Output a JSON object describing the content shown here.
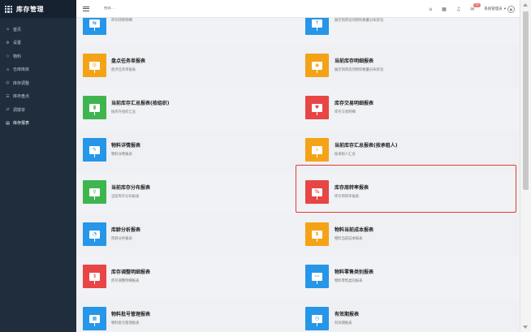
{
  "app": {
    "title": "库存管理"
  },
  "sidebar": {
    "items": [
      {
        "label": "首页",
        "icon": "home-icon",
        "glyph": "⌂",
        "active": false
      },
      {
        "label": "设置",
        "icon": "gear-icon",
        "glyph": "⚙",
        "active": false
      },
      {
        "label": "物料",
        "icon": "cube-icon",
        "glyph": "◇",
        "active": false
      },
      {
        "label": "仓库库房",
        "icon": "warehouse-icon",
        "glyph": "⌂",
        "active": false
      },
      {
        "label": "库存调整",
        "icon": "adjust-icon",
        "glyph": "◎",
        "active": false
      },
      {
        "label": "库存盘点",
        "icon": "check-icon",
        "glyph": "☰",
        "active": false
      },
      {
        "label": "调拨单",
        "icon": "transfer-icon",
        "glyph": "⇄",
        "active": false
      },
      {
        "label": "库存报表",
        "icon": "chart-icon",
        "glyph": "▤",
        "active": true
      }
    ]
  },
  "header": {
    "search_placeholder": "搜索...",
    "notification_count": "10",
    "user_name": "系统管理员"
  },
  "reports": [
    {
      "title": "",
      "desc": "库存转移明细",
      "color": "blue",
      "glyph": "⇆"
    },
    {
      "title": "",
      "desc": "展示到库房的物料数量分布状况",
      "color": "blue",
      "glyph": "⇡"
    },
    {
      "title": "盘点任务单报表",
      "desc": "盘点任务单报表",
      "color": "orange",
      "glyph": "☰"
    },
    {
      "title": "当前库存明细报表",
      "desc": "展示到库房的物料数量分布状况",
      "color": "orange",
      "glyph": "◉"
    },
    {
      "title": "当前库存汇总报表(按组织)",
      "desc": "按库存组织汇总",
      "color": "green",
      "glyph": "▮"
    },
    {
      "title": "库存交易明细报表",
      "desc": "库存交易明细",
      "color": "red",
      "glyph": "♥"
    },
    {
      "title": "物料详情报表",
      "desc": "物料详情报表",
      "color": "blue",
      "glyph": "✎"
    },
    {
      "title": "当前库存汇总报表(按承租人)",
      "desc": "按承租人汇总",
      "color": "orange",
      "glyph": "⇣"
    },
    {
      "title": "当前库存分布报表",
      "desc": "当前库存分布报表",
      "color": "green",
      "glyph": "⚲"
    },
    {
      "title": "库存周转率报表",
      "desc": "库存周转率报表",
      "color": "red",
      "glyph": "%"
    },
    {
      "title": "库龄分析报表",
      "desc": "库龄分析报表",
      "color": "blue",
      "glyph": "◔"
    },
    {
      "title": "物料当前成本报表",
      "desc": "物料当前成本报表",
      "color": "orange",
      "glyph": "$"
    },
    {
      "title": "库存调整明细报表",
      "desc": "库存调整明细报表",
      "color": "red",
      "glyph": "⇕"
    },
    {
      "title": "物料零售类别报表",
      "desc": "物料零售类别报表",
      "color": "blue",
      "glyph": "⋯"
    },
    {
      "title": "物料批号管理报表",
      "desc": "物料批号管理报表",
      "color": "blue",
      "glyph": "▦"
    },
    {
      "title": "有效期报表",
      "desc": "有效期报表",
      "color": "blue",
      "glyph": "◷"
    }
  ],
  "colors": {
    "orange": "#f5a316",
    "blue": "#2596e8",
    "green": "#3fb550",
    "red": "#e84545",
    "highlight": "#e53935",
    "sidebar": "#1f2d3d"
  }
}
